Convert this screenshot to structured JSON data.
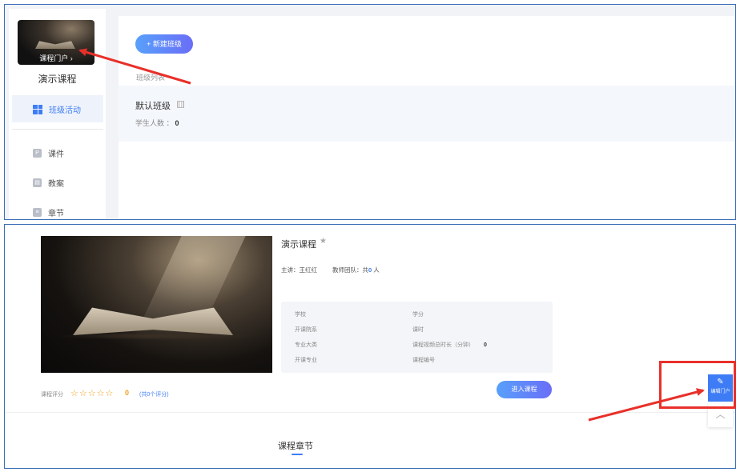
{
  "top": {
    "portal_link": "课程门户 ›",
    "course_title": "演示课程",
    "nav": [
      {
        "label": "班级活动",
        "icon": "grid-icon"
      },
      {
        "label": "课件",
        "icon": "file-icon"
      },
      {
        "label": "教案",
        "icon": "doc-icon"
      },
      {
        "label": "章节",
        "icon": "list-icon"
      }
    ],
    "new_class_button": "+ 新建班级",
    "class_list_label": "班级列表",
    "class_name": "默认班级",
    "student_count_label": "学生人数 ：",
    "student_count_value": "0"
  },
  "bottom": {
    "course_title": "演示课程",
    "teacher": "主讲：王红红",
    "team_prefix": "教师团队：共",
    "team_count": "0",
    "team_suffix": " 人",
    "info": {
      "school": "学校",
      "college": "开课院系",
      "category": "专业大类",
      "major": "开课专业",
      "credit": "学分",
      "hours": "课时",
      "video_length_label": "课程视频总时长（分钟）",
      "video_length_value": "0",
      "course_code": "课程编号"
    },
    "rating_label": "课程评分",
    "rating_stars": "☆☆☆☆☆",
    "rating_value": "0",
    "rating_count": "(共0个评分)",
    "enter_button": "进入课程",
    "chapters_tab": "课程章节",
    "edit_portal_label": "编辑门户",
    "scroll_top_glyph": "︿"
  },
  "colors": {
    "accent": "#3e7cf6",
    "annotation_red": "#e8302a",
    "star": "#f0a020"
  }
}
